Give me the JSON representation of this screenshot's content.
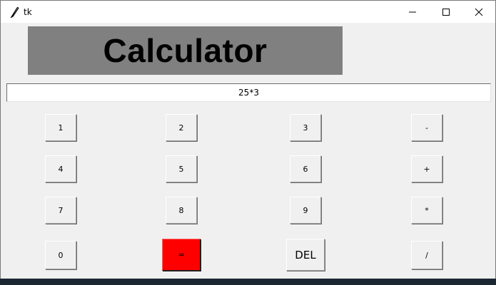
{
  "window": {
    "title": "tk",
    "icons": {
      "app": "feather-icon",
      "minimize": "minimize-icon",
      "maximize": "maximize-icon",
      "close": "close-icon"
    }
  },
  "header": {
    "title": "Calculator",
    "background_color": "#808080"
  },
  "display": {
    "value": "25*3"
  },
  "keys": {
    "one": "1",
    "two": "2",
    "three": "3",
    "minus": "-",
    "four": "4",
    "five": "5",
    "six": "6",
    "plus": "+",
    "seven": "7",
    "eight": "8",
    "nine": "9",
    "multiply": "*",
    "zero": "0",
    "equals": "=",
    "del": "DEL",
    "divide": "/"
  },
  "colors": {
    "equals_button": "#ff0000",
    "window_bg": "#f0f0f0"
  }
}
